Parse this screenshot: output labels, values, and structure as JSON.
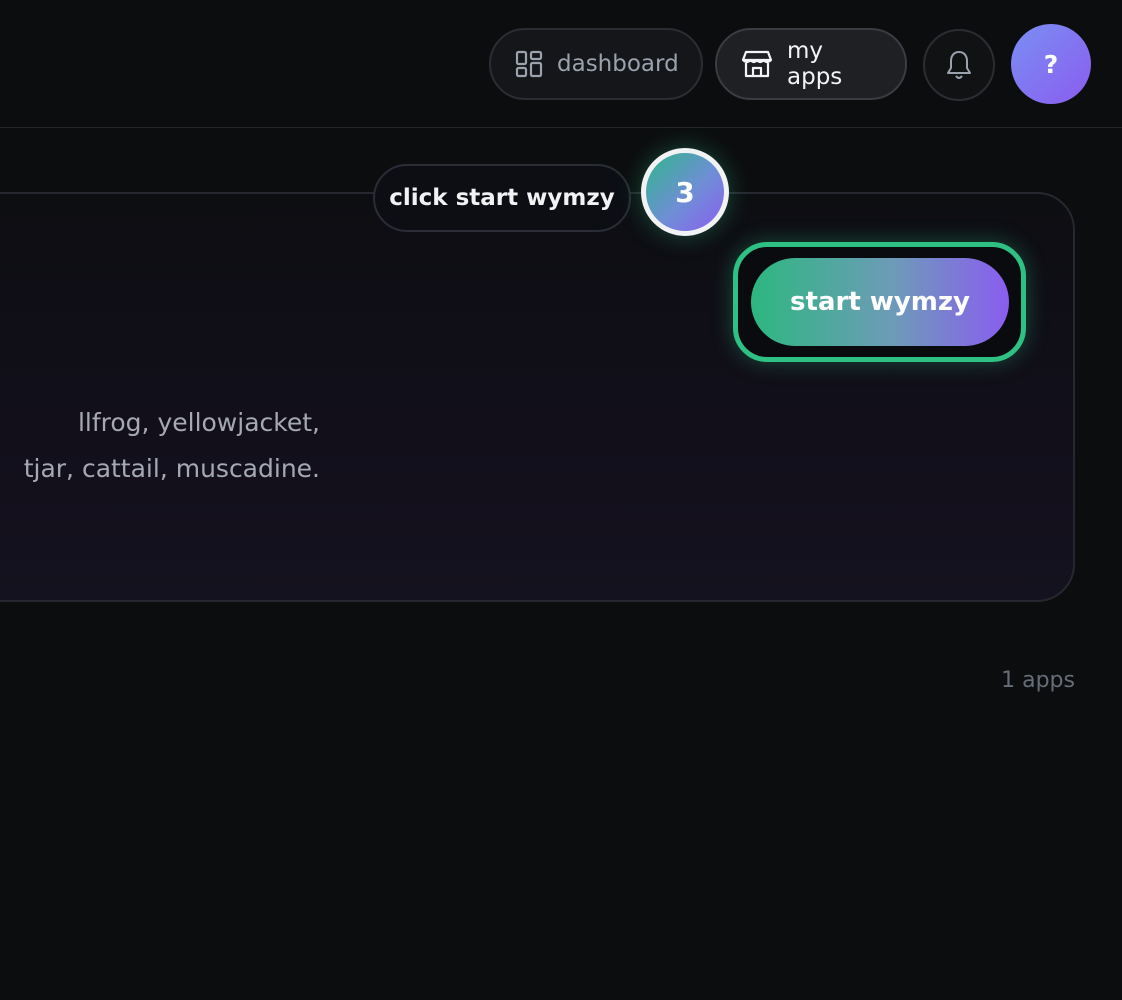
{
  "header": {
    "dashboard_label": "dashboard",
    "my_apps_label": "my apps",
    "avatar_text": "?"
  },
  "tour": {
    "callout_text": "click start wymzy",
    "step_number": "3"
  },
  "card": {
    "description_lines": [
      "llfrog, yellowjacket,",
      "tjar, cattail, muscadine."
    ],
    "start_button_label": "start wymzy"
  },
  "footer": {
    "app_count": "1 apps"
  },
  "colors": {
    "accent_green": "#2fc184",
    "accent_purple": "#8a5cf0",
    "background": "#0c0d0f"
  }
}
